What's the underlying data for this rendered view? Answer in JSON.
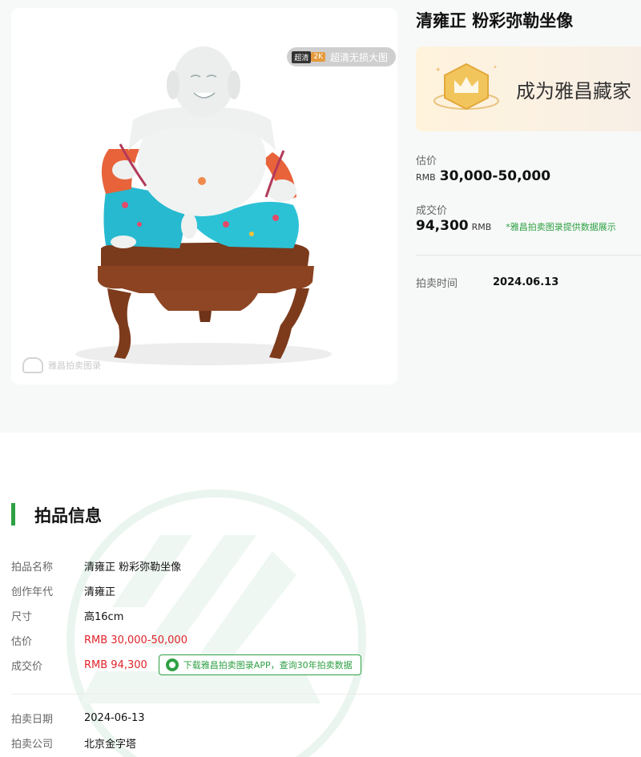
{
  "product": {
    "title": "清雍正 粉彩弥勒坐像",
    "hd_badge": {
      "tag": "超清",
      "res": "2K",
      "text": "超清无损大图"
    },
    "watermark": "雅昌拍卖图录"
  },
  "collector_banner": {
    "text": "成为雅昌藏家"
  },
  "estimate": {
    "label": "估价",
    "currency": "RMB",
    "value": "30,000-50,000"
  },
  "deal": {
    "label": "成交价",
    "value": "94,300",
    "currency": "RMB",
    "note": "*雅昌拍卖图录提供数据展示"
  },
  "auction_time": {
    "label": "拍卖时间",
    "value": "2024.06.13"
  },
  "info": {
    "section_title": "拍品信息",
    "rows": [
      {
        "label": "拍品名称",
        "value": "清雍正 粉彩弥勒坐像"
      },
      {
        "label": "创作年代",
        "value": "清雍正"
      },
      {
        "label": "尺寸",
        "value": "高16cm"
      },
      {
        "label": "估价",
        "value": "RMB 30,000-50,000"
      },
      {
        "label": "成交价",
        "value": "RMB 94,300"
      },
      {
        "label": "拍卖日期",
        "value": "2024-06-13"
      },
      {
        "label": "拍卖公司",
        "value": "北京金字塔"
      }
    ],
    "app_button": "下载雅昌拍卖图录APP，查询30年拍卖数据"
  },
  "colors": {
    "accent": "#2ea043",
    "price_red": "#e0242a"
  }
}
